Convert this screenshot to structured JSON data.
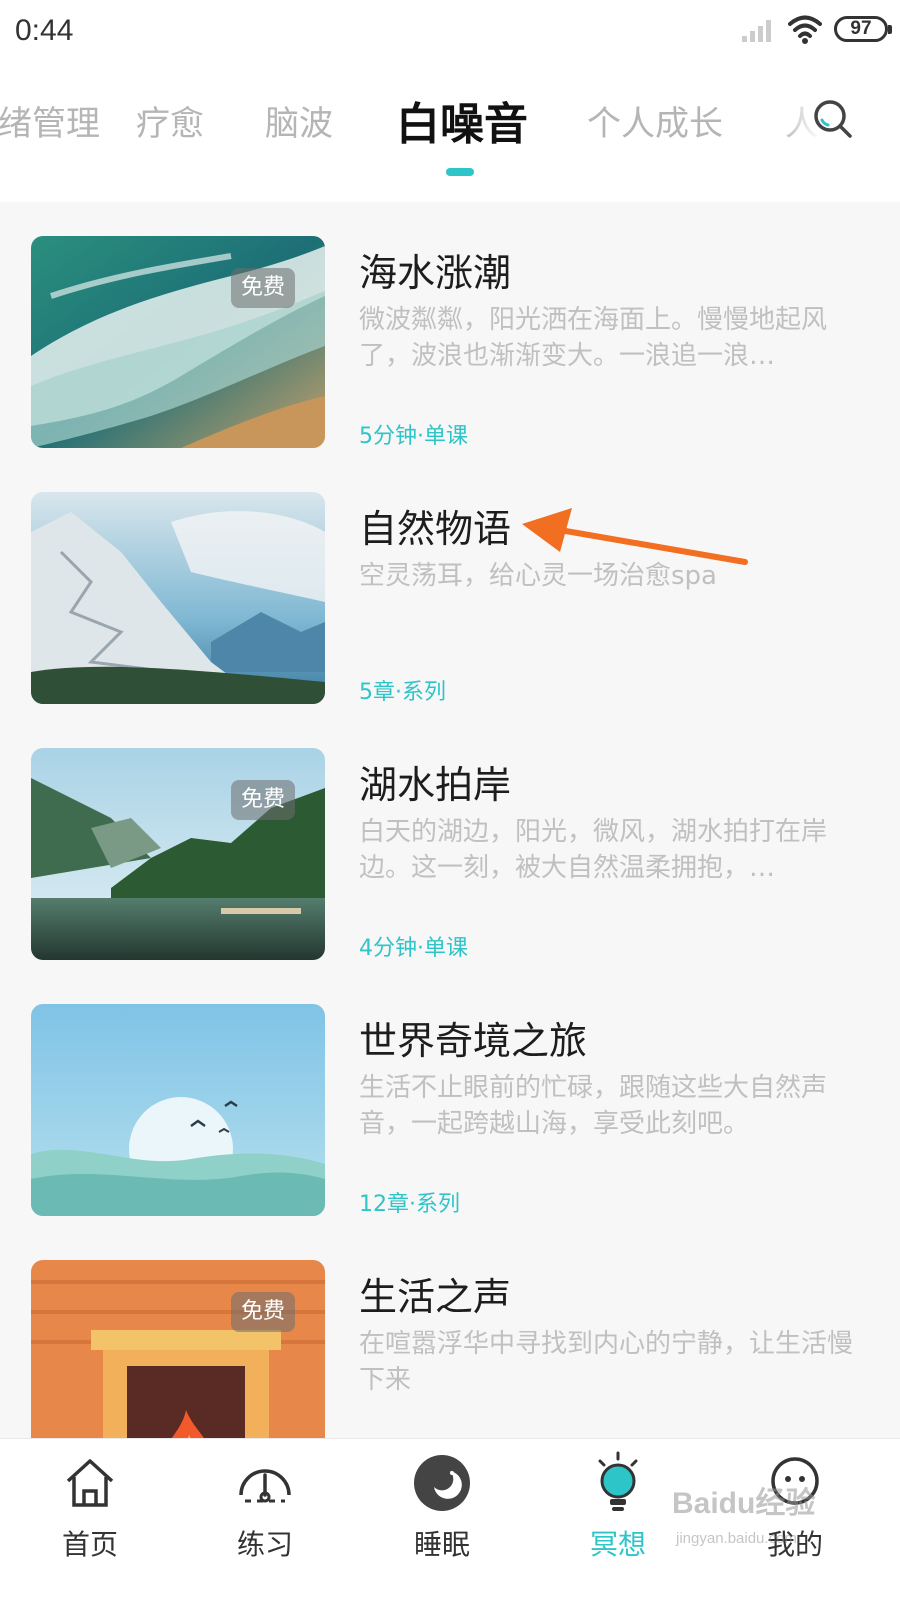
{
  "status_bar": {
    "time": "0:44",
    "battery": "97"
  },
  "tabs": [
    {
      "label": "情绪管理",
      "active": false
    },
    {
      "label": "疗愈",
      "active": false
    },
    {
      "label": "脑波",
      "active": false
    },
    {
      "label": "白噪音",
      "active": true
    },
    {
      "label": "个人成长",
      "active": false
    },
    {
      "label": "人",
      "active": false
    }
  ],
  "search": {
    "icon": "search-icon"
  },
  "items": [
    {
      "title": "海水涨潮",
      "description": "微波粼粼，阳光洒在海面上。慢慢地起风了，波浪也渐渐变大。一浪追一浪…",
      "meta": "5分钟·单课",
      "badge": "免费",
      "image": "ocean-waves"
    },
    {
      "title": "自然物语",
      "description": "空灵荡耳，给心灵一场治愈spa",
      "meta": "5章·系列",
      "badge": "",
      "image": "snowy-mountain"
    },
    {
      "title": "湖水拍岸",
      "description": "白天的湖边，阳光，微风，湖水拍打在岸边。这一刻，被大自然温柔拥抱，…",
      "meta": "4分钟·单课",
      "badge": "免费",
      "image": "lake-forest"
    },
    {
      "title": "世界奇境之旅",
      "description": "生活不止眼前的忙碌，跟随这些大自然声音，一起跨越山海，享受此刻吧。",
      "meta": "12章·系列",
      "badge": "",
      "image": "moon-hills-illustration"
    },
    {
      "title": "生活之声",
      "description": "在喧嚣浮华中寻找到内心的宁静，让生活慢下来",
      "meta": "",
      "badge": "免费",
      "image": "fireplace-illustration"
    }
  ],
  "bottom_nav": [
    {
      "label": "首页",
      "icon": "home-icon",
      "active": false
    },
    {
      "label": "练习",
      "icon": "gauge-icon",
      "active": false
    },
    {
      "label": "睡眠",
      "icon": "moon-icon",
      "active": false
    },
    {
      "label": "冥想",
      "icon": "bulb-icon",
      "active": true
    },
    {
      "label": "我的",
      "icon": "profile-icon",
      "active": false
    }
  ],
  "watermark": {
    "text": "Baidu经验",
    "sub": "jingyan.baidu.com"
  },
  "colors": {
    "accent": "#2ec5c9",
    "annotation_arrow": "#f26f21"
  }
}
